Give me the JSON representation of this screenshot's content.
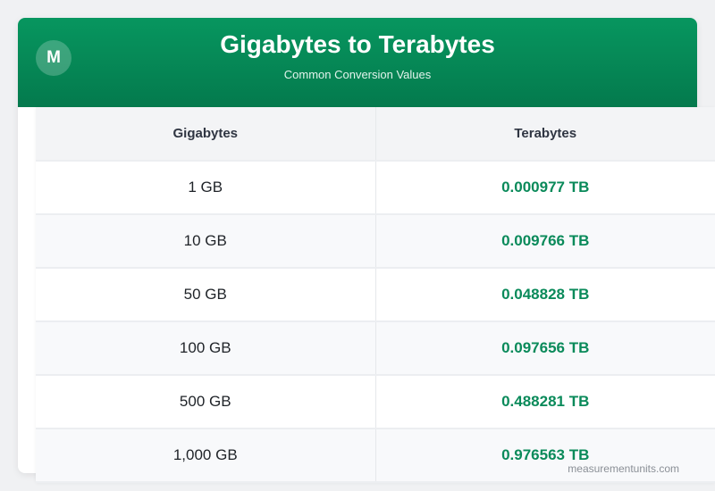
{
  "header": {
    "logo_letter": "M",
    "title": "Gigabytes to Terabytes",
    "subtitle": "Common Conversion Values"
  },
  "table": {
    "columns": [
      "Gigabytes",
      "Terabytes"
    ],
    "rows": [
      {
        "gb": "1 GB",
        "tb": "0.000977 TB"
      },
      {
        "gb": "10 GB",
        "tb": "0.009766 TB"
      },
      {
        "gb": "50 GB",
        "tb": "0.048828 TB"
      },
      {
        "gb": "100 GB",
        "tb": "0.097656 TB"
      },
      {
        "gb": "500 GB",
        "tb": "0.488281 TB"
      },
      {
        "gb": "1,000 GB",
        "tb": "0.976563 TB"
      }
    ]
  },
  "footer": {
    "source": "measurementunits.com"
  },
  "colors": {
    "brand": "#07965f",
    "value": "#0a8a5a"
  }
}
